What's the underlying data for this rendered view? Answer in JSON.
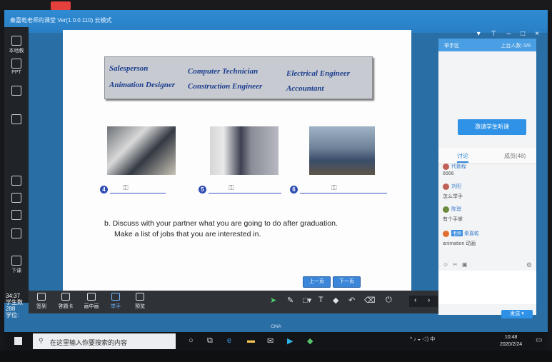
{
  "app": {
    "title": "秦嘉乾老师的课堂 Ver(1.0.0.110) 云模式"
  },
  "leftbar": {
    "items": [
      "本地教",
      "PPT",
      "",
      "",
      "",
      "",
      "",
      "",
      "下课"
    ],
    "timer": "34:37",
    "timer_lines": [
      "学生数",
      "288",
      "学位:"
    ]
  },
  "slide": {
    "jobs": [
      "Salesperson",
      "Computer Technician",
      "Electrical Engineer",
      "Animation Designer",
      "Construction Engineer",
      "Accountant"
    ],
    "numbers": [
      "4",
      "5",
      "6"
    ],
    "task_line1": "b. Discuss with your partner what you are going to do after graduation.",
    "task_line2": "Make a list of jobs that you are interested in.",
    "prev": "上一页",
    "next": "下一页"
  },
  "toolbar": {
    "items": [
      "签到",
      "答题卡",
      "画中画",
      "举手",
      "预览"
    ],
    "active": "举手"
  },
  "right_panel": {
    "header": "举手区",
    "count": "上台人数: 0/6",
    "invite": "邀请学生听课",
    "tab_discuss": "讨论",
    "tab_members": "成员(48)",
    "messages": [
      {
        "name": "代勤程",
        "text": "6666"
      },
      {
        "name": "刘阳",
        "text": ""
      },
      {
        "name": "",
        "text": "怎么举手"
      },
      {
        "name": "陈璟",
        "text": ""
      },
      {
        "name": "",
        "text": "有个手掌"
      },
      {
        "name": "秦嘉乾",
        "badge": "老师",
        "text": "animation 动画"
      }
    ],
    "send": "发送"
  },
  "taskbar": {
    "search_placeholder": "在这里输入你要搜索的内容",
    "time": "10:48",
    "date": "2020/2/24",
    "tray_lang": "中"
  },
  "strip_label": "CINA"
}
